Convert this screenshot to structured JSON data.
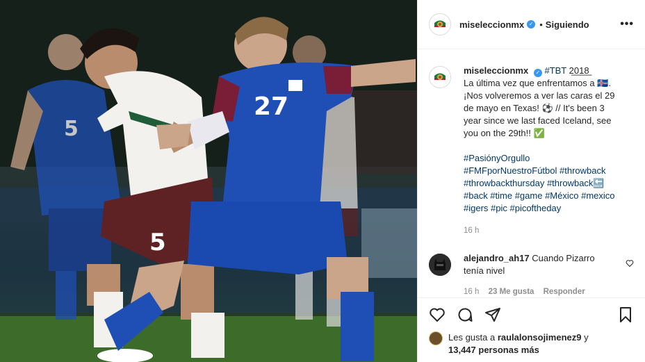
{
  "post": {
    "username": "miseleccionmx",
    "following_label": "Siguiendo",
    "more_label": "•••",
    "caption": {
      "username": "miseleccionmx",
      "hashtag_tbt": "#TBT",
      "year_boxes": "2̲0̲1̲8̲",
      "line1": "La última vez que enfrentamos a 🇮🇸.",
      "line2": "¡Nos volveremos a ver las caras el 29",
      "line3": "de mayo en Texas! ⚽ // It's been 3",
      "line4": "year since we last faced Iceland, see",
      "line5": "you on the 29th!! ✅",
      "hashtags": [
        "#PasiónyOrgullo",
        "#FMFporNuestroFútbol #throwback",
        "#throwbackthursday #throwback🔙",
        "#back #time #game #México #mexico",
        "#igers #pic #picoftheday"
      ],
      "time": "16 h"
    },
    "comment": {
      "username": "alejandro_ah17",
      "text": "Cuando Pizarro",
      "text2": "tenía nivel",
      "time": "16 h",
      "likes": "23 Me gusta",
      "reply_label": "Responder"
    },
    "likes_line": {
      "prefix": "Les gusta a ",
      "user": "raulalonsojimenez9",
      "mid": " y",
      "count": "13,447 personas más"
    }
  },
  "icons": {
    "like": "heart-icon",
    "comment": "comment-icon",
    "share": "paper-plane-icon",
    "save": "bookmark-icon"
  },
  "colors": {
    "iceland_blue": "#1f4fb5",
    "mexico_maroon": "#5e2124",
    "link": "#00376b",
    "verified": "#3897f0"
  }
}
